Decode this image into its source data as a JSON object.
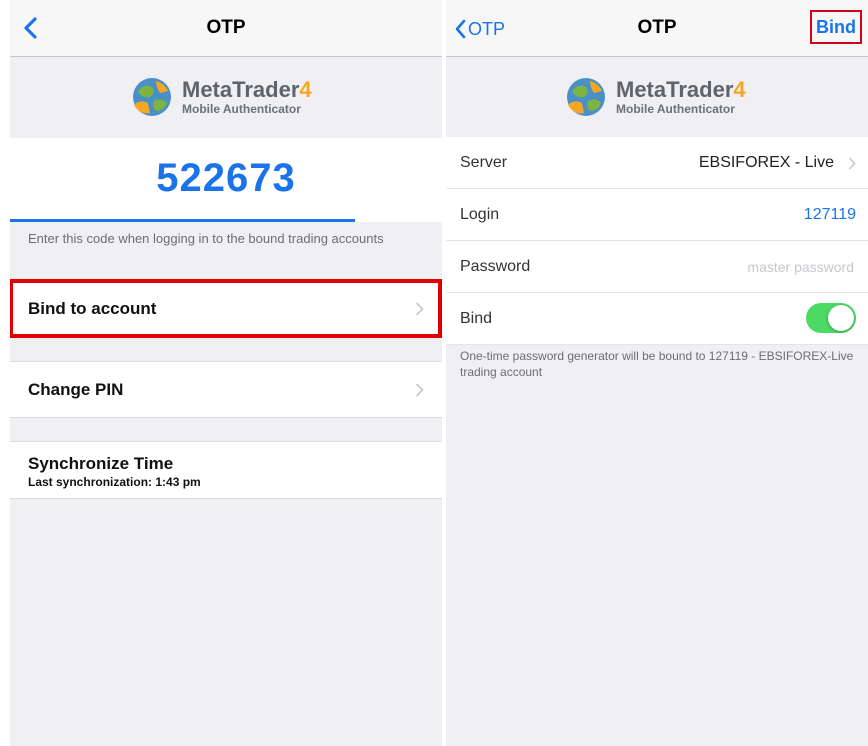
{
  "left": {
    "title": "OTP",
    "logo": {
      "main": "MetaTrader",
      "number": "4",
      "sub": "Mobile Authenticator"
    },
    "code": "522673",
    "hint": "Enter this code when logging in to the bound trading accounts",
    "bind_label": "Bind to account",
    "change_pin_label": "Change PIN",
    "sync_title": "Synchronize Time",
    "sync_subtitle": "Last synchronization: 1:43 pm"
  },
  "right": {
    "back_label": "OTP",
    "title": "OTP",
    "bind_button": "Bind",
    "logo": {
      "main": "MetaTrader",
      "number": "4",
      "sub": "Mobile Authenticator"
    },
    "server": {
      "label": "Server",
      "value": "EBSIFOREX - Live"
    },
    "login": {
      "label": "Login",
      "value": "127119"
    },
    "password": {
      "label": "Password",
      "placeholder": "master password"
    },
    "bind_toggle": {
      "label": "Bind",
      "on": true
    },
    "footnote": "One-time password generator will be bound to 127119 - EBSIFOREX-Live trading account"
  },
  "colors": {
    "accent": "#1a73e8",
    "highlight": "#e00000",
    "toggle_on": "#4cd964",
    "logo_orange": "#f5a623"
  },
  "icons": [
    "chevron-left-icon",
    "chevron-right-icon",
    "metatrader-globe-logo",
    "toggle-switch"
  ]
}
